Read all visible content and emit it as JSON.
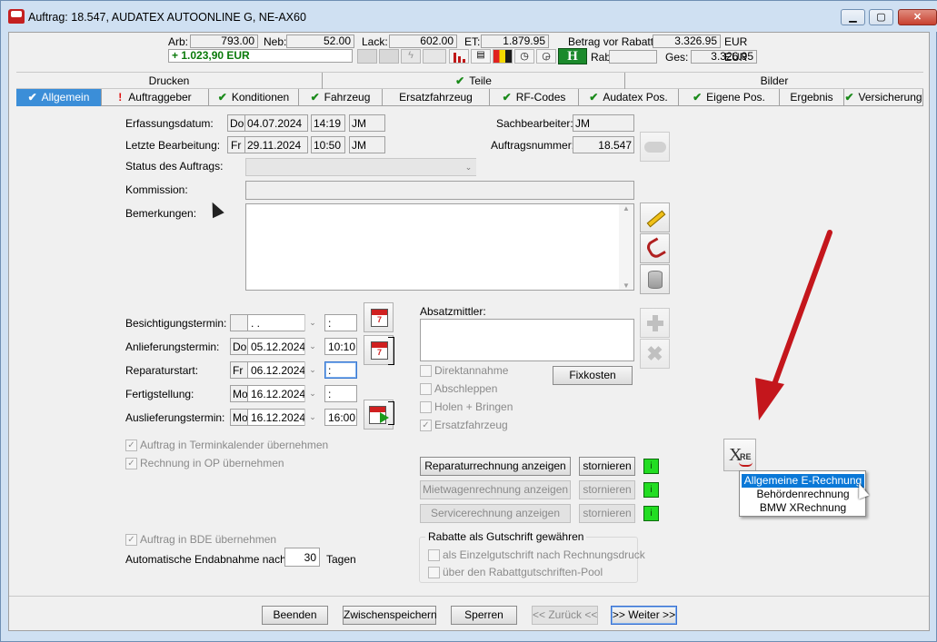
{
  "window": {
    "title": "Auftrag: 18.547, AUDATEX AUTOONLINE G, NE-AX60",
    "min": "▁",
    "max": "▢",
    "close": "✕"
  },
  "summary": {
    "arb_label": "Arb:",
    "arb_value": "793.00",
    "neb_label": "Neb:",
    "neb_value": "52.00",
    "lack_label": "Lack:",
    "lack_value": "602.00",
    "et_label": "ET:",
    "et_value": "1.879.95",
    "rabatt_label": "Betrag vor Rabatt:",
    "rabatt_value": "3.326.95",
    "rabatt_currency": "EUR",
    "rab_label": "Rab:",
    "rab_value": "",
    "ges_label": "Ges:",
    "ges_value": "3.326.95",
    "ges_currency": "EUR",
    "balance": "+ 1.023,90 EUR",
    "toolbar_h": "H"
  },
  "tabs_top": [
    "Drucken",
    "Teile",
    "Bilder"
  ],
  "tabs": [
    {
      "label": "Allgemein",
      "mark": "✔"
    },
    {
      "label": "Auftraggeber",
      "mark": "!"
    },
    {
      "label": "Konditionen",
      "mark": "✔"
    },
    {
      "label": "Fahrzeug",
      "mark": "✔"
    },
    {
      "label": "Ersatzfahrzeug",
      "mark": ""
    },
    {
      "label": "RF-Codes",
      "mark": "✔"
    },
    {
      "label": "Audatex Pos.",
      "mark": "✔"
    },
    {
      "label": "Eigene Pos.",
      "mark": "✔"
    },
    {
      "label": "Ergebnis",
      "mark": ""
    },
    {
      "label": "Versicherung",
      "mark": "✔"
    }
  ],
  "form": {
    "erfassung_label": "Erfassungsdatum:",
    "erfassung_day": "Do",
    "erfassung_date": "04.07.2024",
    "erfassung_time": "14:19",
    "erfassung_user": "JM",
    "bearbeitung_label": "Letzte Bearbeitung:",
    "bearbeitung_day": "Fr",
    "bearbeitung_date": "29.11.2024",
    "bearbeitung_time": "10:50",
    "bearbeitung_user": "JM",
    "sachbearbeiter_label": "Sachbearbeiter:",
    "sachbearbeiter_value": "JM",
    "auftragsnummer_label": "Auftragsnummer:",
    "auftragsnummer_value": "18.547",
    "status_label": "Status des Auftrags:",
    "status_value": "",
    "kommission_label": "Kommission:",
    "kommission_value": "",
    "bemerkungen_label": "Bemerkungen:",
    "bemerkungen_value": ""
  },
  "termine": [
    {
      "label": "Besichtigungstermin:",
      "day": "",
      "date": " .  .",
      "time": ":"
    },
    {
      "label": "Anlieferungstermin:",
      "day": "Do",
      "date": "05.12.2024",
      "time": "10:10"
    },
    {
      "label": "Reparaturstart:",
      "day": "Fr",
      "date": "06.12.2024",
      "time": ":"
    },
    {
      "label": "Fertigstellung:",
      "day": "Mo",
      "date": "16.12.2024",
      "time": ":"
    },
    {
      "label": "Auslieferungstermin:",
      "day": "Mo",
      "date": "16.12.2024",
      "time": "16:00"
    }
  ],
  "absatz": {
    "label": "Absatzmittler:",
    "value": "",
    "options": [
      "Direktannahme",
      "Abschleppen",
      "Holen + Bringen",
      "Ersatzfahrzeug"
    ],
    "checked": [
      false,
      false,
      false,
      true
    ],
    "fixkosten": "Fixkosten"
  },
  "checkboxes": {
    "terminkalender": "Auftrag in Terminkalender übernehmen",
    "op": "Rechnung in OP übernehmen",
    "bde": "Auftrag in BDE übernehmen"
  },
  "endabnahme": {
    "label": "Automatische Endabnahme nach",
    "value": "30",
    "unit": "Tagen"
  },
  "rechnungen": [
    {
      "show": "Reparaturrechnung anzeigen",
      "cancel": "stornieren",
      "info": "i",
      "enabled": true
    },
    {
      "show": "Mietwagenrechnung anzeigen",
      "cancel": "stornieren",
      "info": "i",
      "enabled": false
    },
    {
      "show": "Servicerechnung anzeigen",
      "cancel": "stornieren",
      "info": "i",
      "enabled": false
    }
  ],
  "rabatte": {
    "legend": "Rabatte als Gutschrift gewähren",
    "options": [
      "als Einzelgutschrift nach Rechnungsdruck",
      "über den Rabattgutschriften-Pool"
    ]
  },
  "xre": {
    "label": "X",
    "sub": "RE"
  },
  "context_menu": [
    "Allgemeine E-Rechnung",
    "Behördenrechnung",
    "BMW XRechnung"
  ],
  "bottom_buttons": [
    "Beenden",
    "Zwischenspeichern",
    "Sperren",
    "<< Zurück <<",
    ">> Weiter >>"
  ],
  "colors": {
    "selected_tab": "#3b8ed8",
    "arrow": "#c4161c",
    "menu_highlight": "#0a78d7",
    "info_green": "#22dd22"
  }
}
